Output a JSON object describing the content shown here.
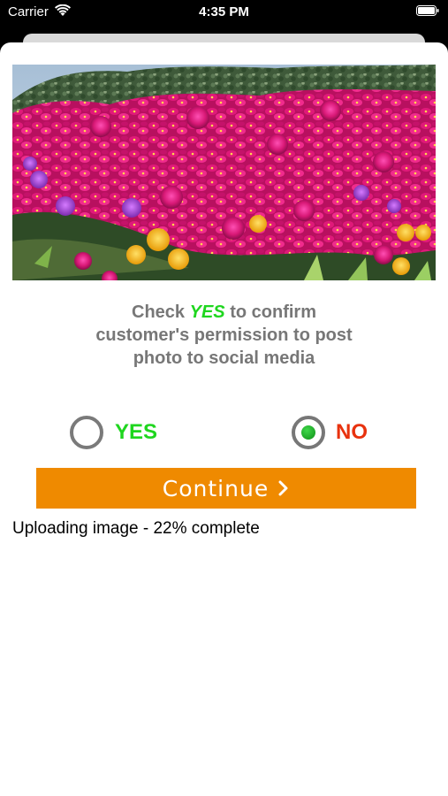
{
  "status_bar": {
    "carrier": "Carrier",
    "time": "4:35 PM",
    "wifi_icon": "wifi-icon",
    "battery_icon": "battery-icon"
  },
  "photo": {
    "description_icon": "flower-field-photo"
  },
  "prompt": {
    "before": "Check ",
    "highlight": "YES",
    "after_line1": " to confirm",
    "line2": "customer's permission to post",
    "line3": "photo to social media"
  },
  "options": {
    "yes_label": "YES",
    "no_label": "NO",
    "selected": "NO",
    "yes_color": "#1fd61f",
    "no_color": "#e8320e"
  },
  "continue_button": {
    "label": "Continue",
    "color": "#ef8a00",
    "icon": "chevron-right-icon"
  },
  "upload_status": {
    "text": "Uploading image - 22% complete",
    "percent": 22
  }
}
